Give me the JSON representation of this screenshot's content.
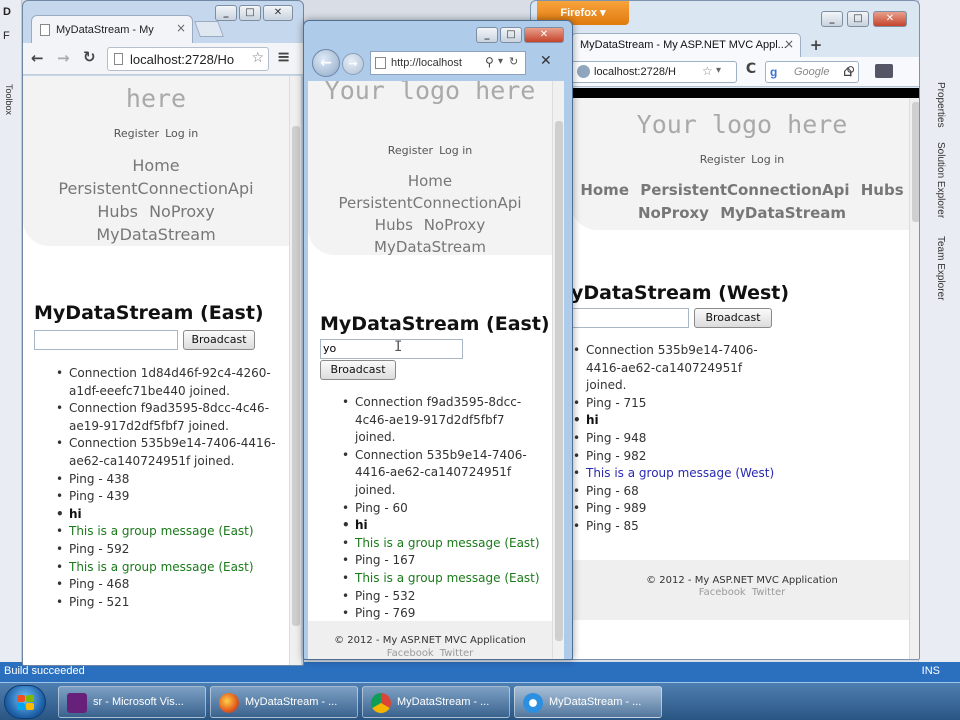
{
  "vs": {
    "left_letters": [
      "D",
      "F"
    ],
    "left_vertical": "Toolbox",
    "right_tabs": [
      "Properties",
      "Solution Explorer",
      "Team Explorer"
    ],
    "status": "Build succeeded",
    "status_right": "INS"
  },
  "taskbar": {
    "items": [
      {
        "label": "sr - Microsoft Vis..."
      },
      {
        "label": "MyDataStream - ..."
      },
      {
        "label": "MyDataStream - ..."
      },
      {
        "label": "MyDataStream - ..."
      }
    ]
  },
  "site": {
    "logo": "Your logo here",
    "logo_part": "here",
    "register": "Register",
    "login": "Log in",
    "nav": [
      "Home",
      "PersistentConnectionApi",
      "Hubs",
      "NoProxy",
      "MyDataStream"
    ],
    "broadcast": "Broadcast",
    "footer": "© 2012 - My ASP.NET MVC Application",
    "facebook": "Facebook",
    "twitter": "Twitter"
  },
  "chrome_window": {
    "tab_title": "MyDataStream - My",
    "url": "localhost:2728/Ho",
    "heading": "MyDataStream (East)",
    "input_value": "",
    "messages": [
      {
        "text": "Connection 1d84d46f-92c4-4260-a1df-eeefc71be440 joined.",
        "style": "normal"
      },
      {
        "text": "Connection f9ad3595-8dcc-4c46-ae19-917d2df5fbf7 joined.",
        "style": "normal"
      },
      {
        "text": "Connection 535b9e14-7406-4416-ae62-ca140724951f joined.",
        "style": "normal"
      },
      {
        "text": "Ping - 438",
        "style": "normal"
      },
      {
        "text": "Ping - 439",
        "style": "normal"
      },
      {
        "text": "hi",
        "style": "bold"
      },
      {
        "text": "This is a group message (East)",
        "style": "green"
      },
      {
        "text": "Ping - 592",
        "style": "normal"
      },
      {
        "text": "This is a group message (East)",
        "style": "green"
      },
      {
        "text": "Ping - 468",
        "style": "normal"
      },
      {
        "text": "Ping - 521",
        "style": "normal"
      }
    ]
  },
  "ie_window": {
    "url": "http://localhost",
    "heading": "MyDataStream (East)",
    "input_value": "yo",
    "messages": [
      {
        "text": "Connection f9ad3595-8dcc-4c46-ae19-917d2df5fbf7 joined.",
        "style": "normal"
      },
      {
        "text": "Connection 535b9e14-7406-4416-ae62-ca140724951f joined.",
        "style": "normal"
      },
      {
        "text": "Ping - 60",
        "style": "normal"
      },
      {
        "text": "hi",
        "style": "bold"
      },
      {
        "text": "This is a group message (East)",
        "style": "green"
      },
      {
        "text": "Ping - 167",
        "style": "normal"
      },
      {
        "text": "This is a group message (East)",
        "style": "green"
      },
      {
        "text": "Ping - 532",
        "style": "normal"
      },
      {
        "text": "Ping - 769",
        "style": "normal"
      }
    ]
  },
  "firefox_window": {
    "app_button": "Firefox",
    "tab_title": "MyDataStream - My ASP.NET MVC Appl...",
    "url": "localhost:2728/H",
    "search_engine": "Google",
    "heading": "MyDataStream (West)",
    "heading_visible": "yDataStream (West)",
    "input_value": "",
    "messages": [
      {
        "text": "Connection 535b9e14-7406-4416-ae62-ca140724951f joined.",
        "style": "normal"
      },
      {
        "text": "Ping - 715",
        "style": "normal"
      },
      {
        "text": "hi",
        "style": "bold"
      },
      {
        "text": "Ping - 948",
        "style": "normal"
      },
      {
        "text": "Ping - 982",
        "style": "normal"
      },
      {
        "text": "This is a group message (West)",
        "style": "blue"
      },
      {
        "text": "Ping - 68",
        "style": "normal"
      },
      {
        "text": "Ping - 989",
        "style": "normal"
      },
      {
        "text": "Ping - 85",
        "style": "normal"
      }
    ]
  },
  "colors": {
    "group_east": "#1a7a1a",
    "group_west": "#2a2ab0",
    "vs_status": "#2b6fbf"
  }
}
